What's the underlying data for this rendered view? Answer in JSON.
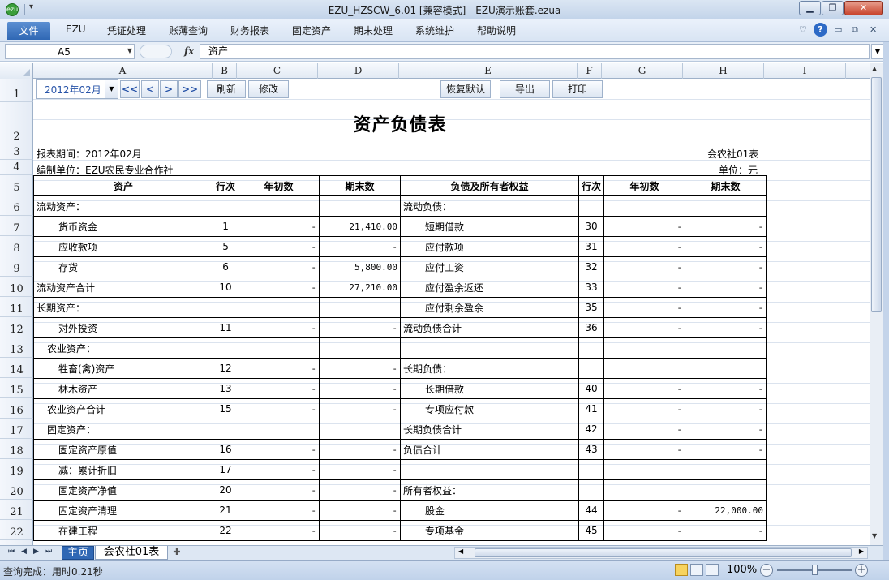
{
  "window": {
    "title": "EZU_HZSCW_6.01  [兼容模式] - EZU演示账套.ezua",
    "app_icon_text": "ezu"
  },
  "ribbon": {
    "file_label": "文件",
    "menus": [
      "EZU",
      "凭证处理",
      "账薄查询",
      "财务报表",
      "固定资产",
      "期末处理",
      "系统维护",
      "帮助说明"
    ]
  },
  "formula_bar": {
    "cell_ref": "A5",
    "fx_label": "fx",
    "content": "资产"
  },
  "columns": [
    "A",
    "B",
    "C",
    "D",
    "E",
    "F",
    "G",
    "H",
    "I"
  ],
  "rows": [
    "1",
    "2",
    "3",
    "4",
    "5",
    "6",
    "7",
    "8",
    "9",
    "10",
    "11",
    "12",
    "13",
    "14",
    "15",
    "16",
    "17",
    "18",
    "19",
    "20",
    "21",
    "22"
  ],
  "controls": {
    "period_value": "2012年02月",
    "nav_first": "<<",
    "nav_prev": "<",
    "nav_next": ">",
    "nav_last": ">>",
    "refresh_label": "刷新",
    "edit_label": "修改",
    "restore_label": "恢复默认",
    "export_label": "导出",
    "print_label": "打印"
  },
  "report": {
    "title": "资产负债表",
    "period_label": "报表期间：2012年02月",
    "org_label": "编制单位：EZU农民专业合作社",
    "form_code": "会农社01表",
    "unit_label": "单位：元",
    "headers": [
      "资产",
      "行次",
      "年初数",
      "期末数",
      "负债及所有者权益",
      "行次",
      "年初数",
      "期末数"
    ],
    "rows": [
      [
        "流动资产：",
        "",
        "",
        "",
        "流动负债：",
        "",
        "",
        ""
      ],
      [
        "货币资金",
        "1",
        "-",
        "21,410.00",
        "短期借款",
        "30",
        "-",
        "-"
      ],
      [
        "应收款项",
        "5",
        "-",
        "-",
        "应付款项",
        "31",
        "-",
        "-"
      ],
      [
        "存货",
        "6",
        "-",
        "5,800.00",
        "应付工资",
        "32",
        "-",
        "-"
      ],
      [
        "流动资产合计",
        "10",
        "-",
        "27,210.00",
        "应付盈余返还",
        "33",
        "-",
        "-"
      ],
      [
        "长期资产：",
        "",
        "",
        "",
        "应付剩余盈余",
        "35",
        "-",
        "-"
      ],
      [
        "对外投资",
        "11",
        "-",
        "-",
        "流动负债合计",
        "36",
        "-",
        "-"
      ],
      [
        "农业资产：",
        "",
        "",
        "",
        "",
        "",
        "",
        ""
      ],
      [
        "牲畜(禽)资产",
        "12",
        "-",
        "-",
        "长期负债：",
        "",
        "",
        ""
      ],
      [
        "林木资产",
        "13",
        "-",
        "-",
        "长期借款",
        "40",
        "-",
        "-"
      ],
      [
        "农业资产合计",
        "15",
        "-",
        "-",
        "专项应付款",
        "41",
        "-",
        "-"
      ],
      [
        "固定资产：",
        "",
        "",
        "",
        "长期负债合计",
        "42",
        "-",
        "-"
      ],
      [
        "固定资产原值",
        "16",
        "-",
        "-",
        "负债合计",
        "43",
        "-",
        "-"
      ],
      [
        "减：累计折旧",
        "17",
        "-",
        "-",
        "",
        "",
        "",
        ""
      ],
      [
        "固定资产净值",
        "20",
        "-",
        "-",
        "所有者权益：",
        "",
        "",
        ""
      ],
      [
        "固定资产清理",
        "21",
        "-",
        "-",
        "股金",
        "44",
        "-",
        "22,000.00"
      ],
      [
        "在建工程",
        "22",
        "-",
        "-",
        "专项基金",
        "45",
        "-",
        "-"
      ]
    ]
  },
  "sheets": {
    "main_tab": "主页",
    "report_tab": "会农社01表"
  },
  "status": {
    "text": "查询完成：用时0.21秒",
    "zoom": "100%"
  }
}
